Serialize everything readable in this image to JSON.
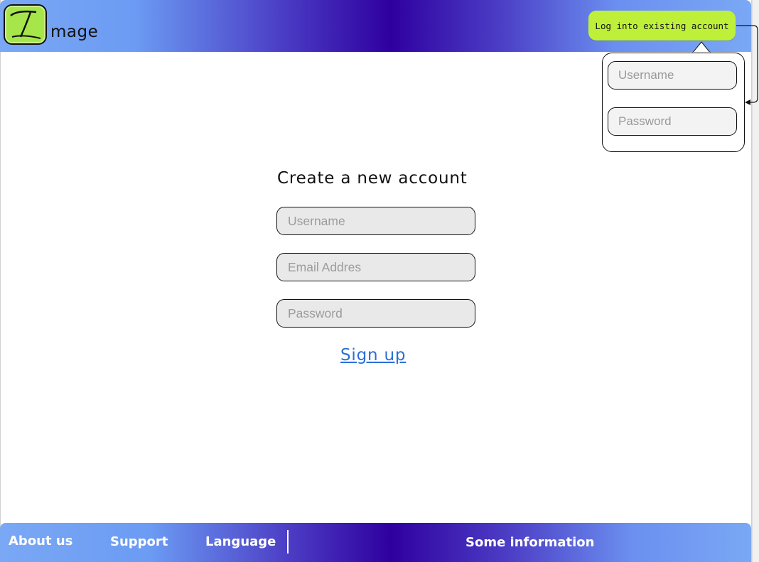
{
  "header": {
    "logo_text": "mage",
    "login_button_label": "Log into existing account"
  },
  "login_popover": {
    "username_placeholder": "Username",
    "password_placeholder": "Password"
  },
  "signup_form": {
    "title": "Create a new account",
    "username_placeholder": "Username",
    "email_placeholder": "Email Addres",
    "password_placeholder": "Password",
    "submit_label": "Sign up"
  },
  "footer": {
    "links": [
      "About us",
      "Support",
      "Language"
    ],
    "info_text": "Some information"
  },
  "colors": {
    "accent_green": "#bef03a",
    "header_deep_blue": "#2f009f",
    "header_light_blue": "#7aa8f5",
    "link_blue": "#2b6fd6"
  },
  "icons": {
    "logo": "logo-icon",
    "connector": "connector-arrow-icon"
  }
}
